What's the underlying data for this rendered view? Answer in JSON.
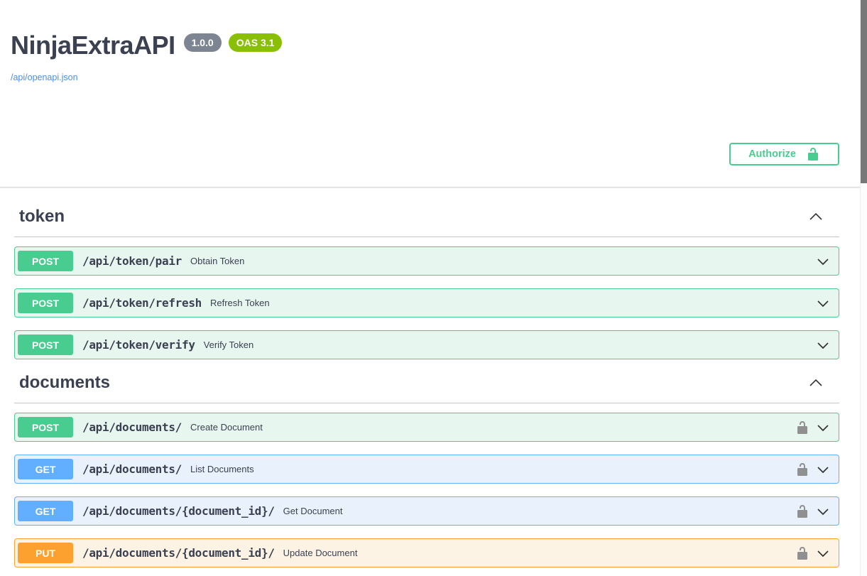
{
  "header": {
    "title": "NinjaExtraAPI",
    "version_badge": "1.0.0",
    "oas_badge": "OAS 3.1",
    "spec_link": "/api/openapi.json"
  },
  "auth": {
    "authorize_label": "Authorize"
  },
  "methods": {
    "POST": {
      "color": "#49cc90",
      "bg": "#e8f6f0"
    },
    "GET": {
      "color": "#61affe",
      "bg": "#e9f2fc"
    },
    "PUT": {
      "color": "#fca130",
      "bg": "#fdf3e5"
    }
  },
  "colors": {
    "text": "#3b4151",
    "link": "#4990e2",
    "version_pill": "#7d8492",
    "oas_pill": "#89bf04",
    "authorize_green": "#49cc90",
    "lock_gray": "#909090"
  },
  "icons": {
    "authorize_lock": "unlocked-padlock-icon",
    "row_lock": "unlocked-padlock-icon",
    "section_toggle": "chevron-up-icon",
    "row_toggle": "chevron-down-icon"
  },
  "sections": [
    {
      "name": "token",
      "expanded": true,
      "endpoints": [
        {
          "method": "POST",
          "path": "/api/token/pair",
          "summary": "Obtain Token",
          "locked": false
        },
        {
          "method": "POST",
          "path": "/api/token/refresh",
          "summary": "Refresh Token",
          "locked": false
        },
        {
          "method": "POST",
          "path": "/api/token/verify",
          "summary": "Verify Token",
          "locked": false
        }
      ]
    },
    {
      "name": "documents",
      "expanded": true,
      "endpoints": [
        {
          "method": "POST",
          "path": "/api/documents/",
          "summary": "Create Document",
          "locked": true
        },
        {
          "method": "GET",
          "path": "/api/documents/",
          "summary": "List Documents",
          "locked": true
        },
        {
          "method": "GET",
          "path": "/api/documents/{document_id}/",
          "summary": "Get Document",
          "locked": true
        },
        {
          "method": "PUT",
          "path": "/api/documents/{document_id}/",
          "summary": "Update Document",
          "locked": true
        }
      ]
    }
  ]
}
